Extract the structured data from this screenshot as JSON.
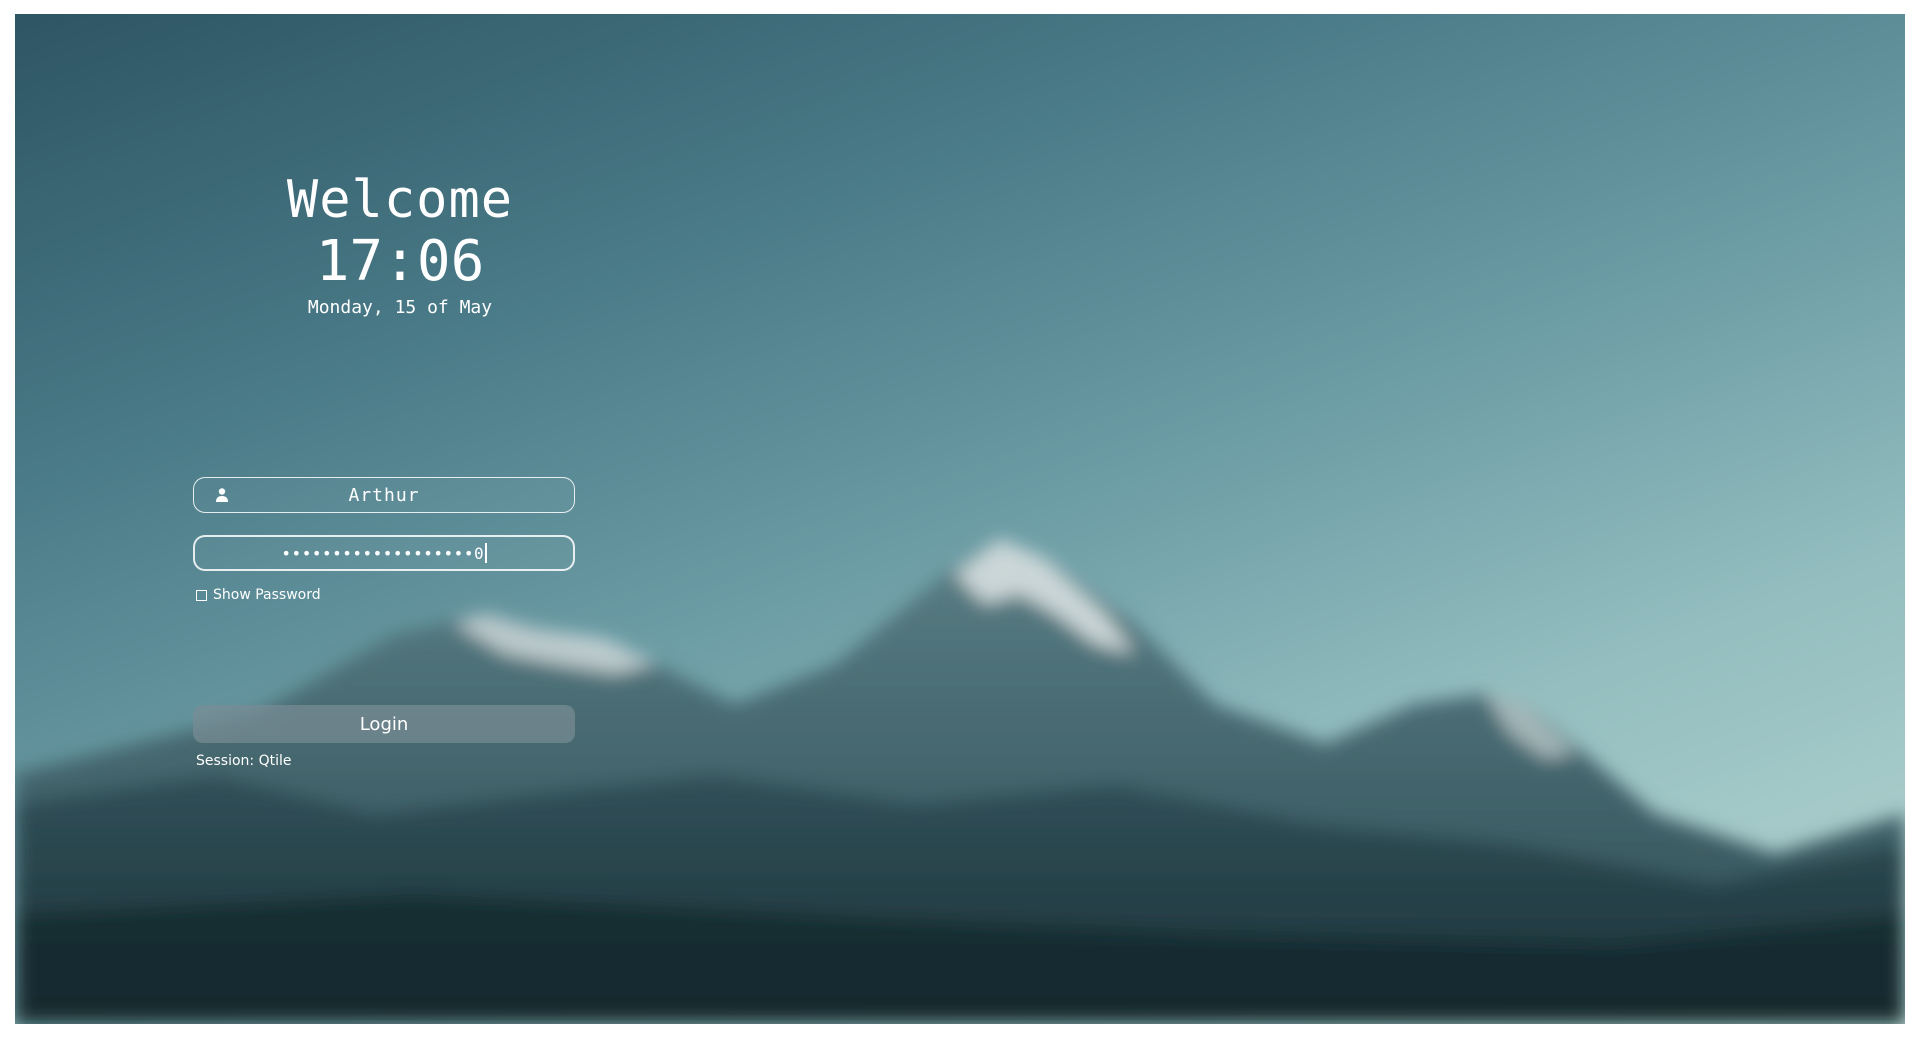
{
  "greeting": {
    "welcome": "Welcome",
    "time": "17:06",
    "date": "Monday, 15 of May"
  },
  "login_form": {
    "username_icon": "user-icon",
    "username_value": "Arthur",
    "password_mask": "•••••••••••••••••••0",
    "show_password_label": "Show Password",
    "show_password_checked": false,
    "login_label": "Login",
    "session_label": "Session: Qtile"
  },
  "colors": {
    "sky_dark": "#2e5563",
    "sky_light": "#b6d6d2",
    "text": "#ffffff",
    "button_bg": "#788c94"
  }
}
